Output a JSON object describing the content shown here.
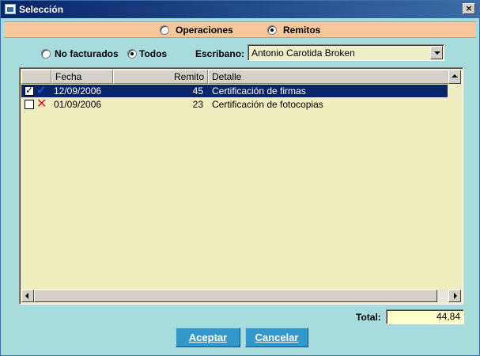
{
  "window": {
    "title": "Selección",
    "close_label": "×"
  },
  "mode": {
    "options": [
      {
        "label": "Operaciones",
        "selected": false
      },
      {
        "label": "Remitos",
        "selected": true
      }
    ]
  },
  "filter": {
    "options": [
      {
        "label": "No facturados",
        "selected": false
      },
      {
        "label": "Todos",
        "selected": true
      }
    ],
    "escribano_label": "Escribano:",
    "escribano_value": "Antonio Carotida Broken"
  },
  "grid": {
    "columns": [
      "",
      "Fecha",
      "Remito",
      "Detalle"
    ],
    "rows": [
      {
        "checked": true,
        "status": "check",
        "fecha": "12/09/2006",
        "remito": "45",
        "detalle": "Certificación de firmas",
        "selected": true
      },
      {
        "checked": false,
        "status": "cross",
        "fecha": "01/09/2006",
        "remito": "23",
        "detalle": "Certificación de fotocopias",
        "selected": false
      }
    ]
  },
  "total": {
    "label": "Total:",
    "value": "44,84"
  },
  "buttons": {
    "accept": "Aceptar",
    "cancel": "Cancelar"
  },
  "colors": {
    "titlebar": "#0a246a",
    "background": "#a8dcdc",
    "mode_bar": "#f5c79a",
    "grid_bg": "#eeeec0",
    "button": "#3399cc"
  }
}
